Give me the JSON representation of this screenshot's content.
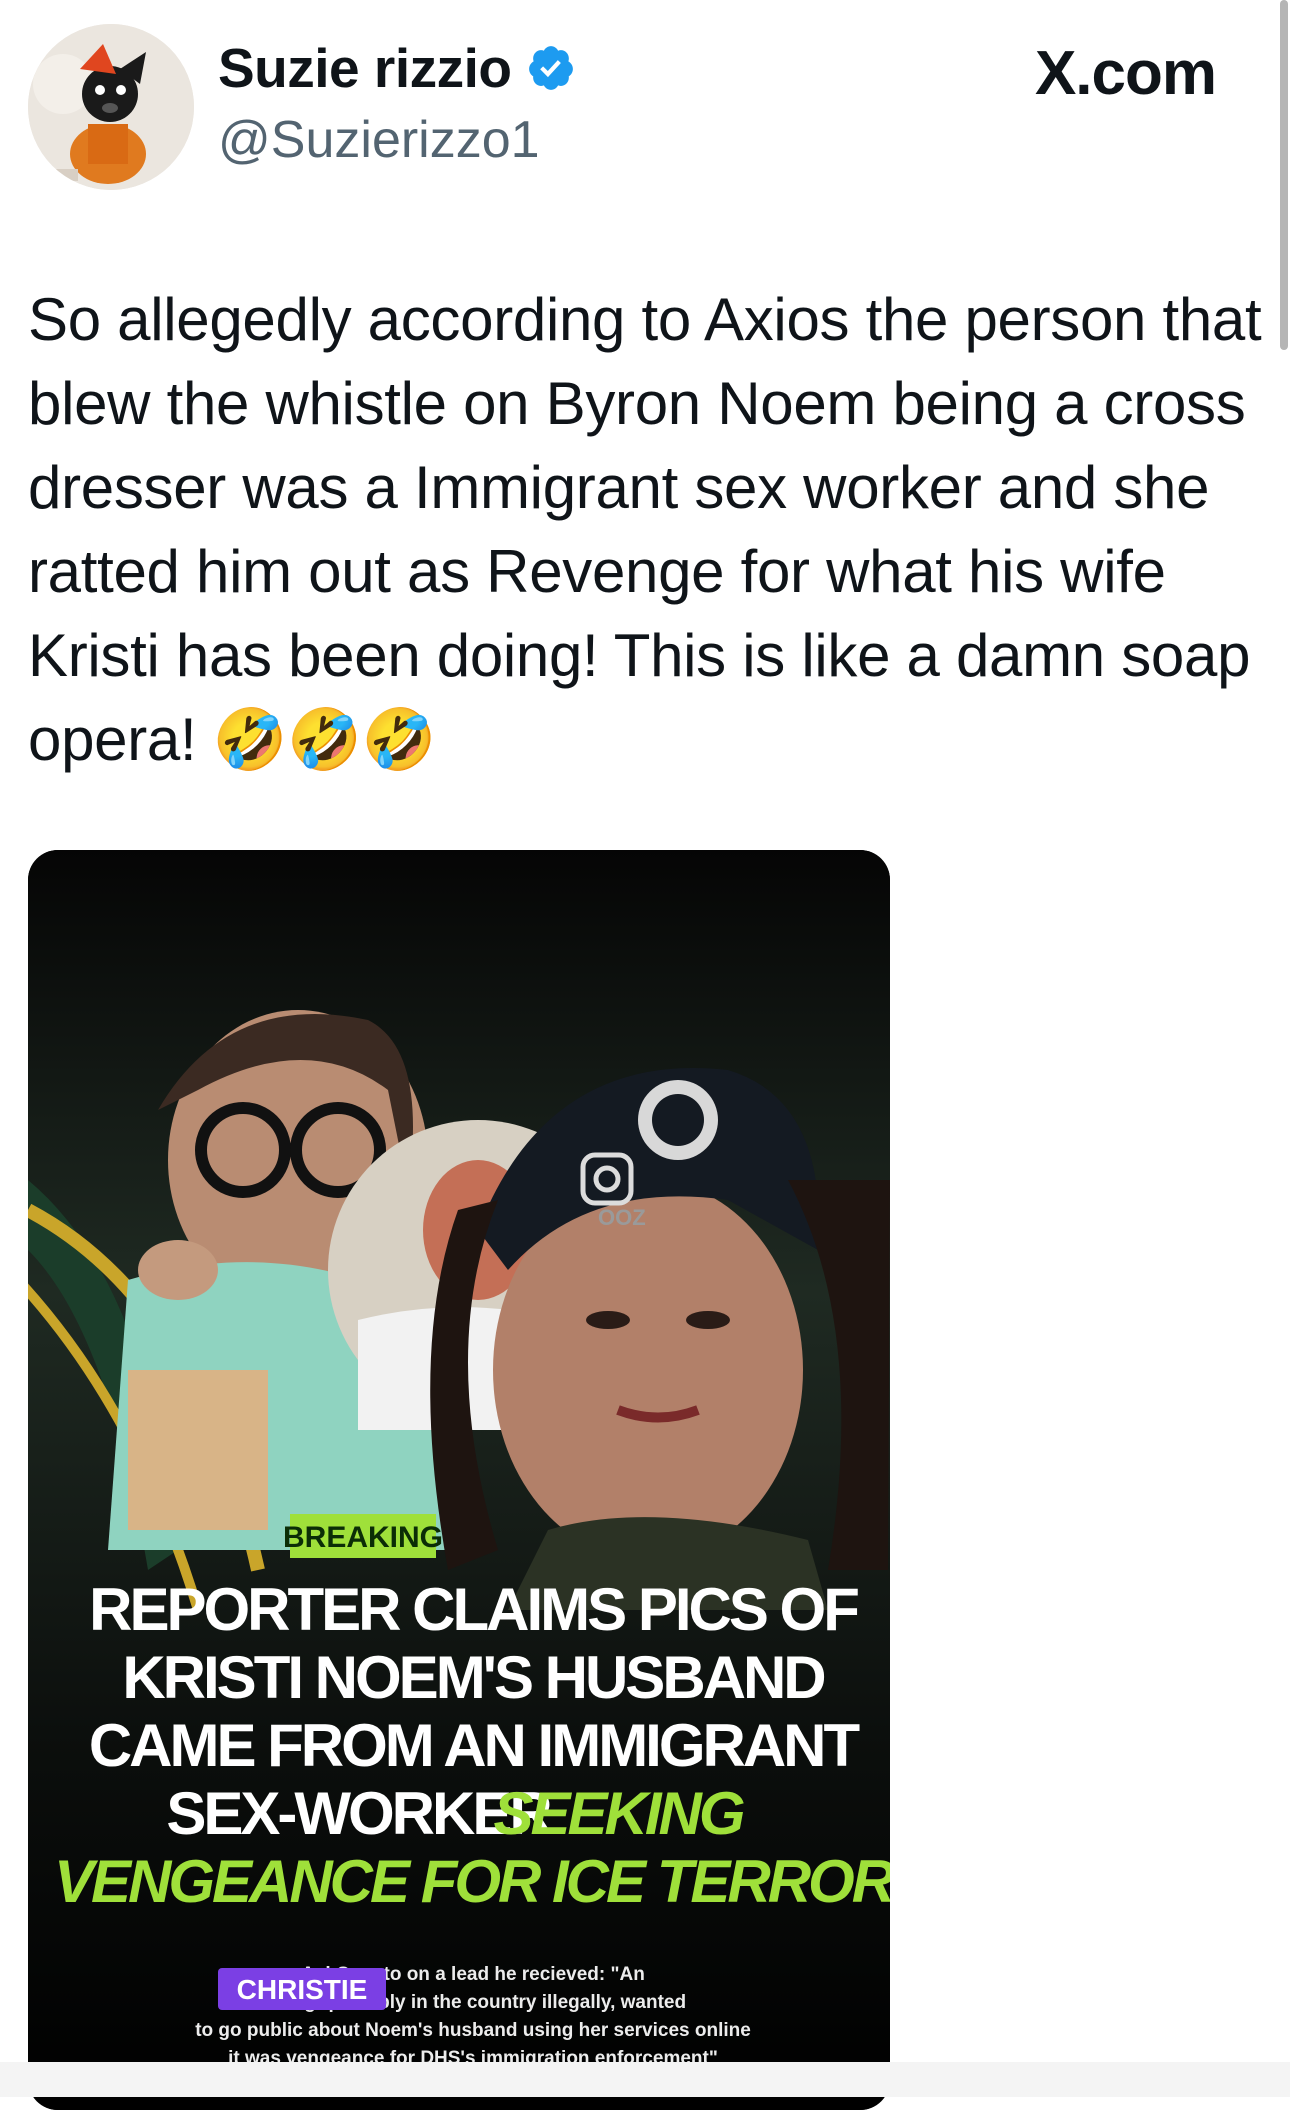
{
  "tweet": {
    "author_name": "Suzie rizzio",
    "author_handle": "@Suzierizzo1",
    "source_label": "X.com",
    "text": "So allegedly according to Axios the person that blew the whistle on Byron Noem being a cross dresser was a Immigrant sex worker and she ratted him out as Revenge for what his wife Kristi has been doing! This is like a damn soap opera! 🤣🤣🤣"
  },
  "media": {
    "badge": "BREAKING",
    "headline_white": [
      "REPORTER CLAIMS PICS OF",
      "KRISTI NOEM'S HUSBAND",
      "CAME FROM AN IMMIGRANT",
      "SEX-WORKER"
    ],
    "headline_green_inline": "SEEKING",
    "headline_green_line": "VENGEANCE FOR ICE TERROR",
    "name_tag": "CHRISTIE",
    "caption_lines": [
      "Axi                         Caputo on a lead he recieved: \"An",
      "Immigr                       possibly in the country illegally, wanted",
      "to go public about Noem's husband using her services online",
      "it was vengeance for DHS's immigration enforcement\""
    ],
    "watermark": "OOZ"
  },
  "colors": {
    "verified_blue": "#1d9bf0",
    "accent_green": "#9fe03a",
    "name_tag_purple": "#7b3fe4"
  }
}
